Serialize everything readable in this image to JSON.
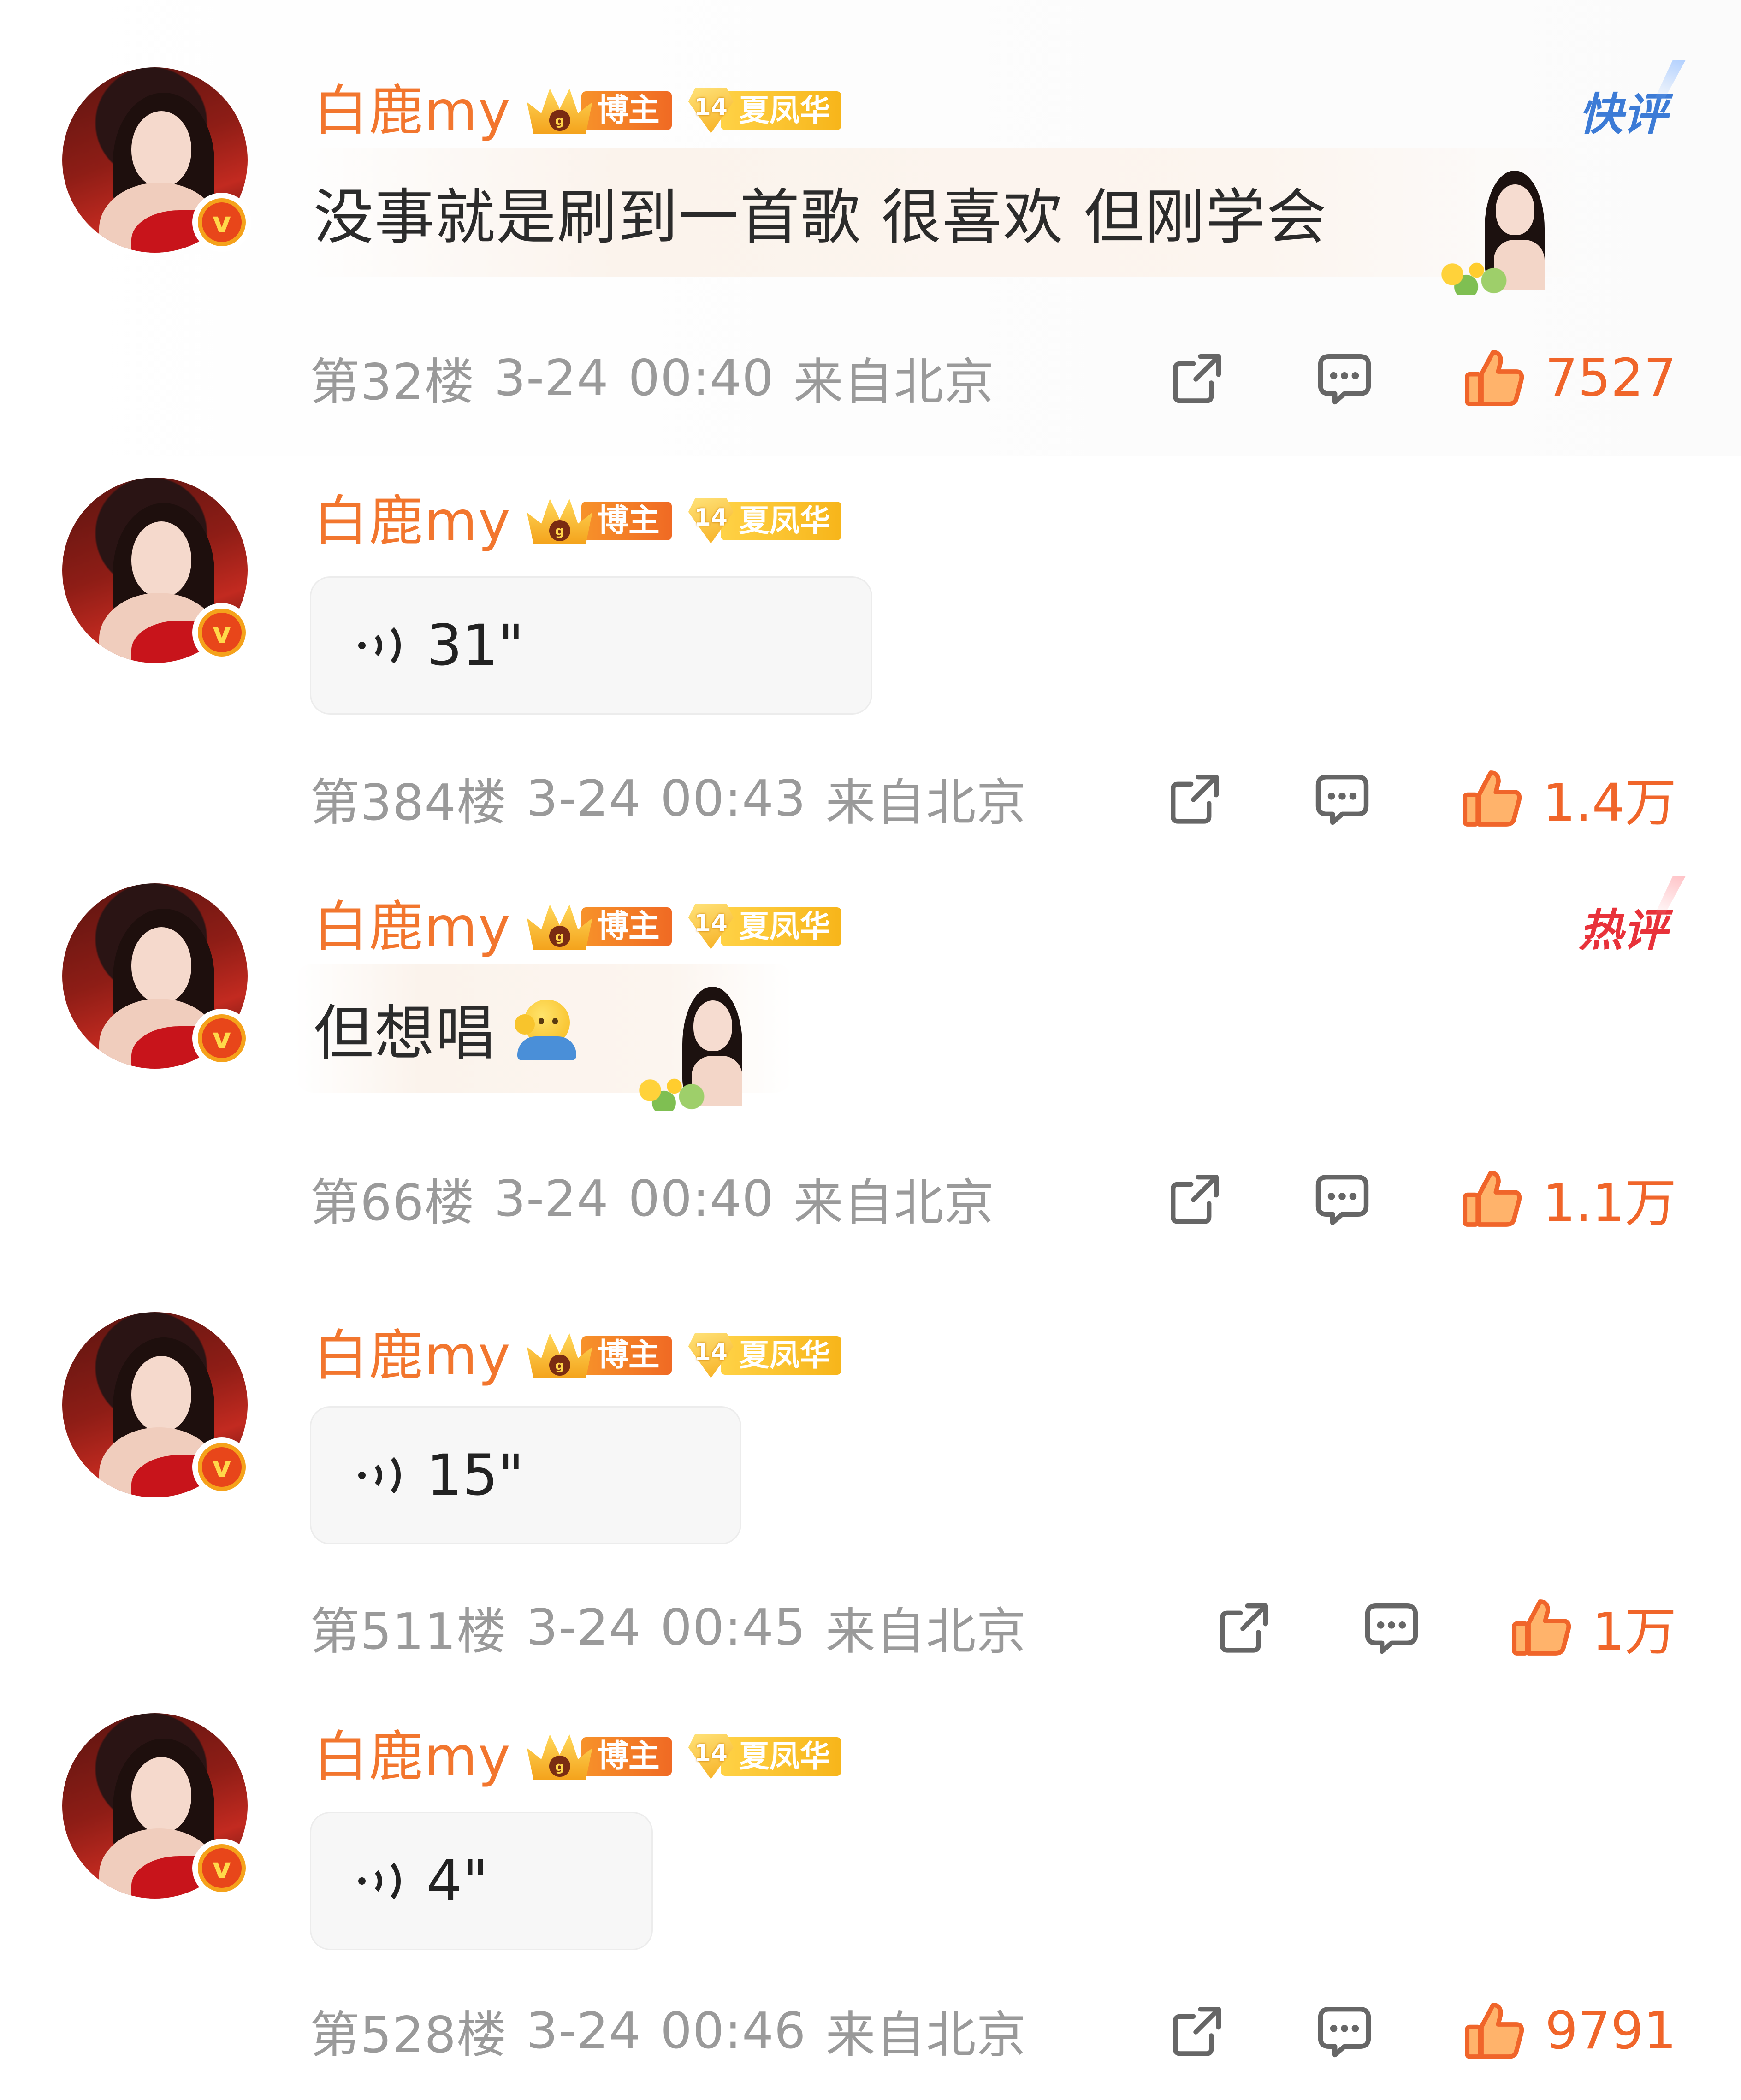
{
  "comments": [
    {
      "username": "白鹿my",
      "badge_blogger": "博主",
      "badge_level_num": "14",
      "badge_level_label": "夏凤华",
      "tag": "快评",
      "text": "没事就是刷到一首歌 很喜欢 但刚学会",
      "floor": "第32楼",
      "date": "3-24",
      "time": "00:40",
      "location": "来自北京",
      "likes": "7527"
    },
    {
      "username": "白鹿my",
      "badge_blogger": "博主",
      "badge_level_num": "14",
      "badge_level_label": "夏凤华",
      "voice_duration": "31\"",
      "floor": "第384楼",
      "date": "3-24",
      "time": "00:43",
      "location": "来自北京",
      "likes": "1.4万"
    },
    {
      "username": "白鹿my",
      "badge_blogger": "博主",
      "badge_level_num": "14",
      "badge_level_label": "夏凤华",
      "tag": "热评",
      "text": "但想唱",
      "emoji": "salute-emoji",
      "floor": "第66楼",
      "date": "3-24",
      "time": "00:40",
      "location": "来自北京",
      "likes": "1.1万"
    },
    {
      "username": "白鹿my",
      "badge_blogger": "博主",
      "badge_level_num": "14",
      "badge_level_label": "夏凤华",
      "voice_duration": "15\"",
      "floor": "第511楼",
      "date": "3-24",
      "time": "00:45",
      "location": "来自北京",
      "likes": "1万"
    },
    {
      "username": "白鹿my",
      "badge_blogger": "博主",
      "badge_level_num": "14",
      "badge_level_label": "夏凤华",
      "voice_duration": "4\"",
      "floor": "第528楼",
      "date": "3-24",
      "time": "00:46",
      "location": "来自北京",
      "likes": "9791"
    }
  ],
  "colors": {
    "username": "#f2762e",
    "meta": "#9a9a9a",
    "like": "#f0652a",
    "quick_tag": "#3c7bd6",
    "hot_tag": "#e8323a"
  },
  "icons": {
    "share": "share-icon",
    "comment": "comment-icon",
    "like": "thumbs-up-icon",
    "voice": "voice-wave-icon",
    "verified": "verified-v-icon"
  }
}
